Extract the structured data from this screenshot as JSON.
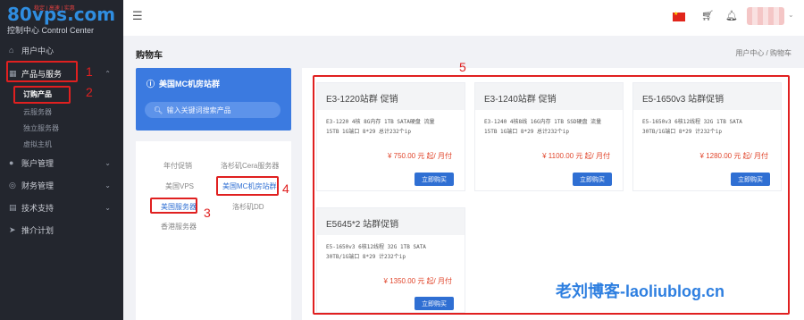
{
  "logo": {
    "brand": "80vps.com",
    "tagline": "稳定 | 高速 | 实惠",
    "subtitle": "控制中心 Control Center"
  },
  "sidebar": {
    "items": [
      {
        "label": "用户中心",
        "icon": "home-icon"
      },
      {
        "label": "产品与服务",
        "icon": "grid-icon"
      },
      {
        "label": "账户管理",
        "icon": "user-icon"
      },
      {
        "label": "财务管理",
        "icon": "money-icon"
      },
      {
        "label": "技术支持",
        "icon": "support-icon"
      },
      {
        "label": "推介计划",
        "icon": "send-icon"
      }
    ],
    "sub_items": [
      "订购产品",
      "云服务器",
      "独立服务器",
      "虚拟主机"
    ]
  },
  "topbar": {
    "menu_icon": "hamburger-icon",
    "flag": "china-flag-icon",
    "cart_icon": "cart-icon",
    "bell_icon": "bell-icon"
  },
  "page": {
    "title": "购物车",
    "breadcrumb": "用户中心 / 购物车"
  },
  "blue_card": {
    "title": "美国MC机房站群",
    "search_placeholder": "输入关键词搜索产品"
  },
  "categories": {
    "left": [
      "年付促销",
      "美国VPS",
      "美国服务器",
      "香港服务器"
    ],
    "right": [
      "洛杉矶Cera服务器",
      "美国MC机房站群",
      "洛杉矶DD"
    ]
  },
  "products": [
    {
      "title": "E3-1220站群 促销",
      "desc1": "E3-1220 4核 8G内存 1TB SATA硬盘 流量",
      "desc2": "15TB 1G端口 8*29 总计232个ip",
      "price": "¥ 750.00 元 起/ 月付",
      "buy": "立即购买"
    },
    {
      "title": "E3-1240站群 促销",
      "desc1": "E3-1240 4核8线 16G内存 1TB SSD硬盘 流量",
      "desc2": "15TB 1G端口 8*29 总计232个ip",
      "price": "¥ 1100.00 元 起/ 月付",
      "buy": "立即购买"
    },
    {
      "title": "E5-1650v3 站群促销",
      "desc1": "E5-1650v3 6核12线程 32G 1TB SATA",
      "desc2": "30TB/1G端口 8*29 计232个ip",
      "price": "¥ 1280.00 元 起/ 月付",
      "buy": "立即购买"
    },
    {
      "title": "E5645*2 站群促销",
      "desc1": "E5-1650v3 6核12线程 32G 1TB SATA",
      "desc2": "30TB/1G端口 8*29 计232个ip",
      "price": "¥ 1350.00 元 起/ 月付",
      "buy": "立即购买"
    }
  ],
  "annotations": [
    "1",
    "2",
    "3",
    "4",
    "5"
  ],
  "watermark": "老刘博客-laoliublog.cn",
  "colors": {
    "sidebar_bg": "#23262e",
    "accent_blue": "#3b7ae0",
    "price_red": "#e0452b",
    "annotation_red": "#e02020"
  }
}
